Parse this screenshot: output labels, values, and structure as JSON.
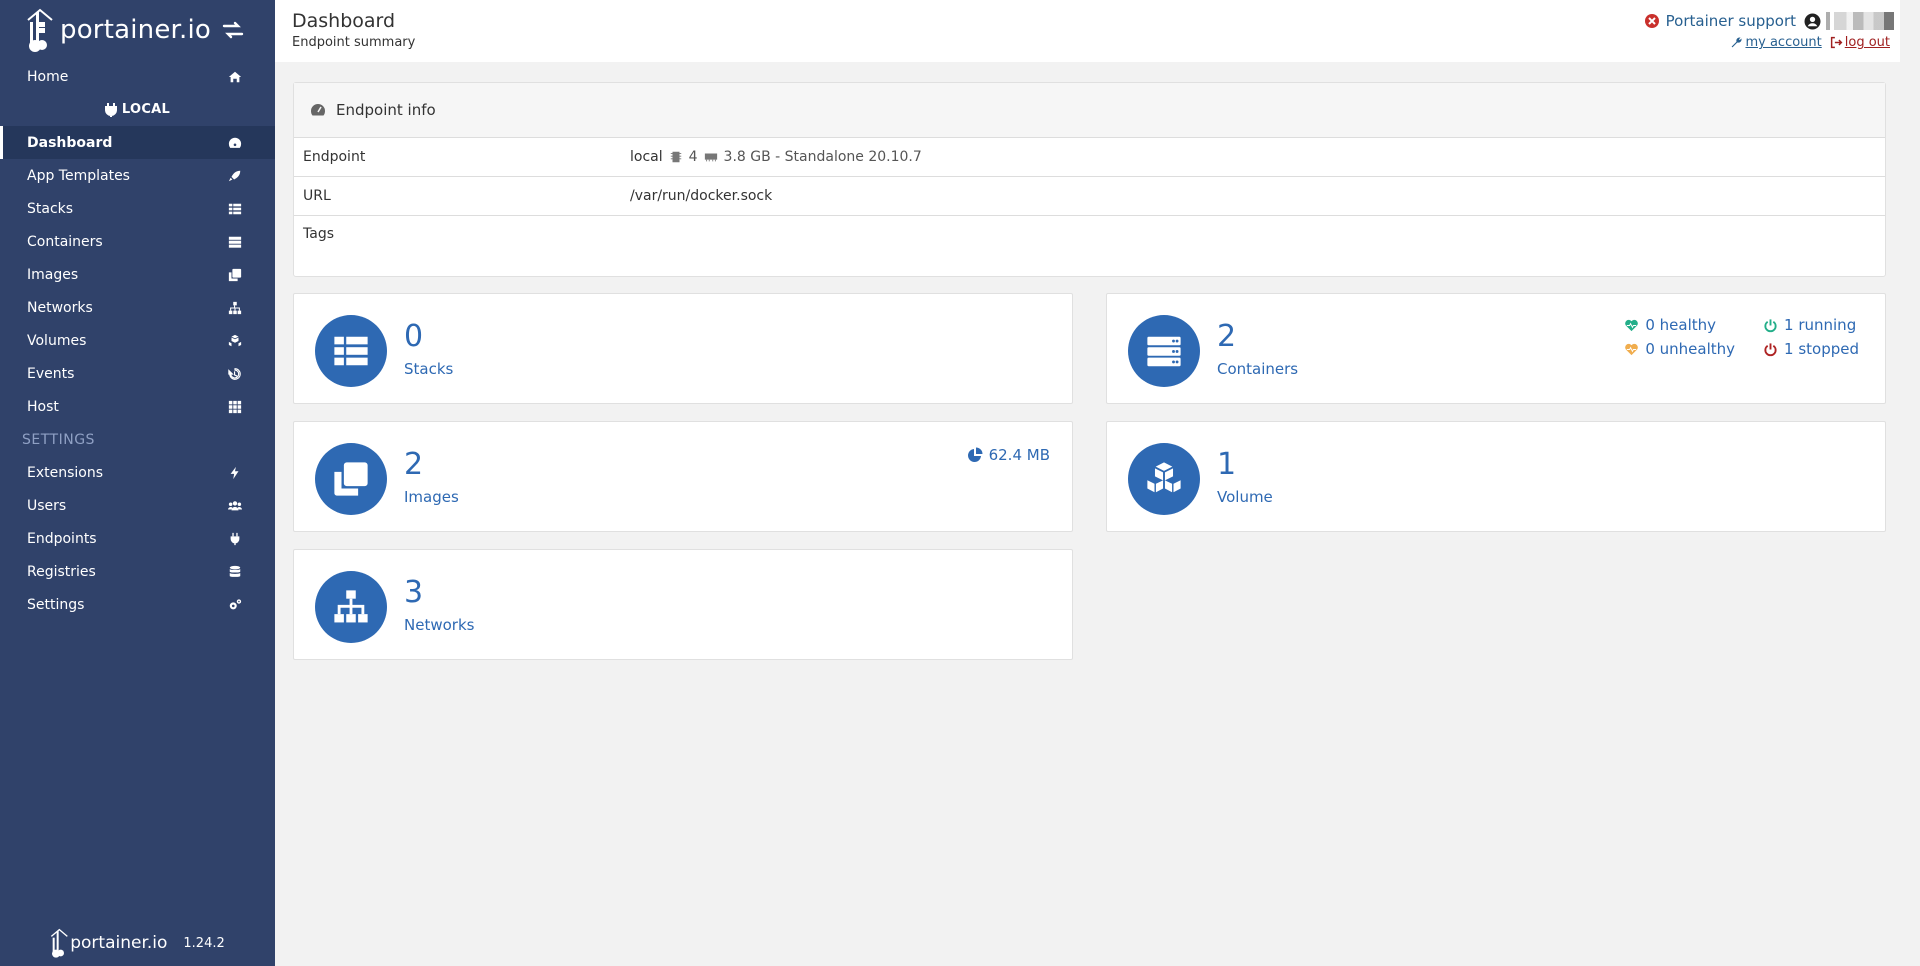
{
  "sidebar": {
    "brand": "portainer.io",
    "endpoint_label": "LOCAL",
    "items": [
      {
        "label": "Home",
        "icon": "home-icon"
      },
      {
        "label": "Dashboard",
        "icon": "tachometer-icon"
      },
      {
        "label": "App Templates",
        "icon": "rocket-icon"
      },
      {
        "label": "Stacks",
        "icon": "th-list-icon"
      },
      {
        "label": "Containers",
        "icon": "server-icon"
      },
      {
        "label": "Images",
        "icon": "clone-icon"
      },
      {
        "label": "Networks",
        "icon": "sitemap-icon"
      },
      {
        "label": "Volumes",
        "icon": "cubes-icon"
      },
      {
        "label": "Events",
        "icon": "history-icon"
      },
      {
        "label": "Host",
        "icon": "th-icon"
      }
    ],
    "settings_heading": "SETTINGS",
    "settings_items": [
      {
        "label": "Extensions",
        "icon": "bolt-icon"
      },
      {
        "label": "Users",
        "icon": "users-icon"
      },
      {
        "label": "Endpoints",
        "icon": "plug-icon"
      },
      {
        "label": "Registries",
        "icon": "database-icon"
      },
      {
        "label": "Settings",
        "icon": "cogs-icon"
      }
    ],
    "footer_brand": "portainer.io",
    "version": "1.24.2"
  },
  "header": {
    "title": "Dashboard",
    "subtitle": "Endpoint summary",
    "support_label": "Portainer support",
    "my_account_label": " my account",
    "logout_label": " log out"
  },
  "endpoint_info": {
    "title": "Endpoint info",
    "rows": {
      "endpoint": {
        "key": "Endpoint",
        "name": "local",
        "cpu": "4",
        "memory_desc": "3.8 GB - Standalone 20.10.7"
      },
      "url": {
        "key": "URL",
        "value": "/var/run/docker.sock"
      },
      "tags": {
        "key": "Tags",
        "value": ""
      }
    }
  },
  "tiles": {
    "stacks": {
      "count": "0",
      "label": "Stacks"
    },
    "containers": {
      "count": "2",
      "label": "Containers",
      "healthy": "0 healthy",
      "running": "1 running",
      "unhealthy": "0 unhealthy",
      "stopped": "1 stopped"
    },
    "images": {
      "count": "2",
      "label": "Images",
      "size": "62.4 MB"
    },
    "volumes": {
      "count": "1",
      "label": "Volume"
    },
    "networks": {
      "count": "3",
      "label": "Networks"
    }
  },
  "colors": {
    "sidebar_bg": "#30426a",
    "accent": "#2e69b3",
    "healthy": "#23ae89",
    "unhealthy": "#f0ad4e",
    "running": "#23ae89",
    "stopped": "#ae2323",
    "logout": "#a02020"
  }
}
